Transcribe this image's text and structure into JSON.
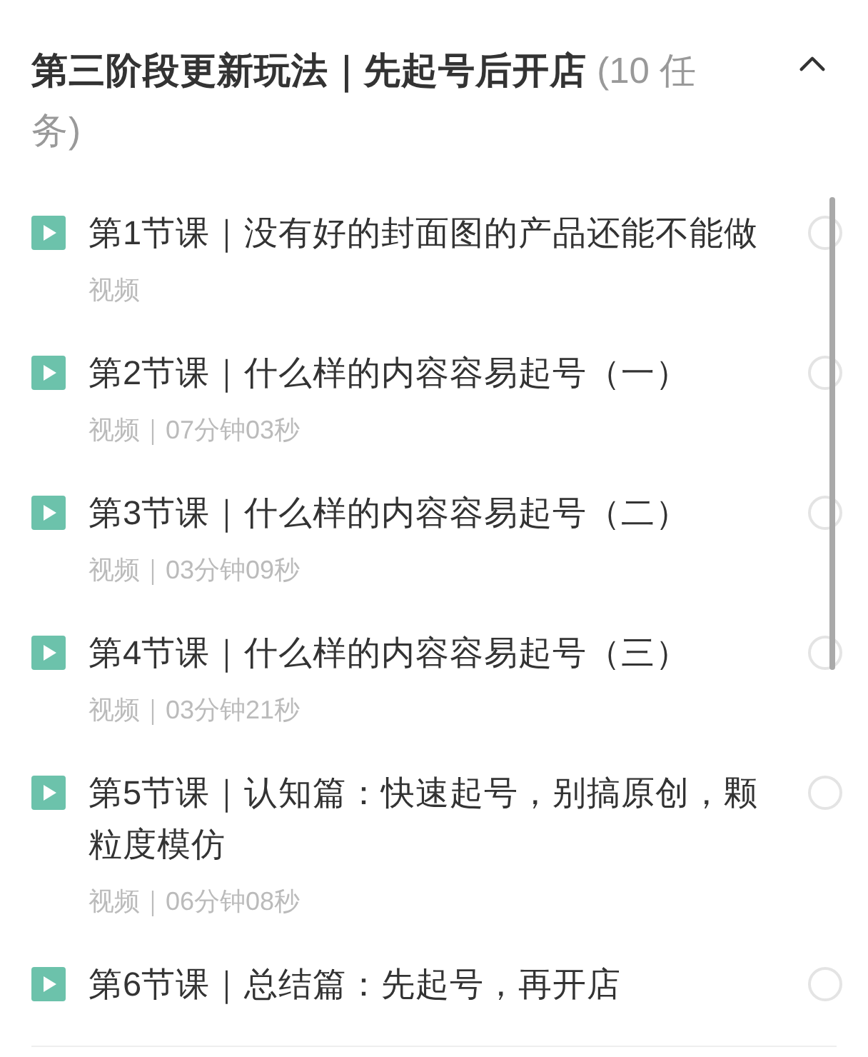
{
  "section": {
    "title": "**第三阶段更新玩法｜先起号后开店** (10 任务)",
    "expanded": true
  },
  "lessons": [
    {
      "title": "第1节课｜没有好的封面图的产品还能不能做",
      "meta": "视频",
      "completed": false
    },
    {
      "title": "第2节课｜什么样的内容容易起号（一）",
      "meta": "视频｜07分钟03秒",
      "completed": false
    },
    {
      "title": "第3节课｜什么样的内容容易起号（二）",
      "meta": "视频｜03分钟09秒",
      "completed": false
    },
    {
      "title": "第4节课｜什么样的内容容易起号（三）",
      "meta": "视频｜03分钟21秒",
      "completed": false
    },
    {
      "title": "第5节课｜认知篇：快速起号，别搞原创，颗粒度模仿",
      "meta": "视频｜06分钟08秒",
      "completed": false
    },
    {
      "title": "第6节课｜总结篇：先起号，再开店",
      "completed": false
    }
  ]
}
